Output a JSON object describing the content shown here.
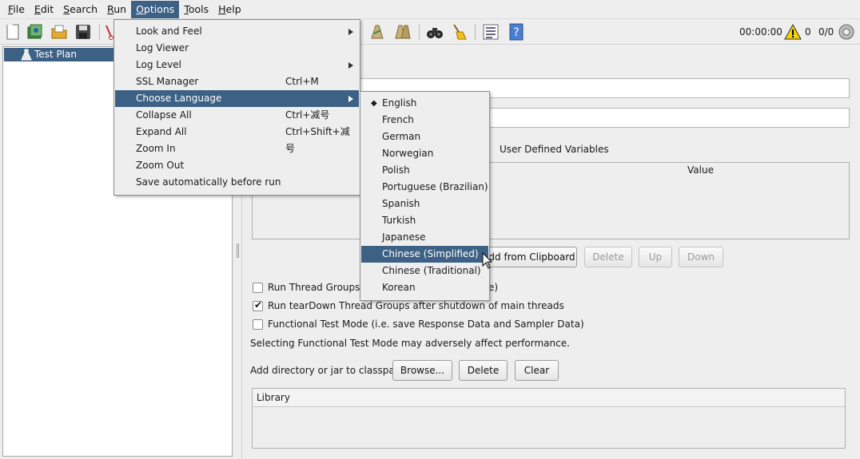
{
  "menubar": {
    "items": [
      "File",
      "Edit",
      "Search",
      "Run",
      "Options",
      "Tools",
      "Help"
    ],
    "active": "Options"
  },
  "toolbar": {
    "timer": "00:00:00",
    "warning_count": "0",
    "thread_ratio": "0/0"
  },
  "tree": {
    "root_label": "Test Plan"
  },
  "options_menu": {
    "items": [
      {
        "label": "Look and Feel",
        "accel": "",
        "submenu": true
      },
      {
        "label": "Log Viewer",
        "accel": "",
        "submenu": false
      },
      {
        "label": "Log Level",
        "accel": "",
        "submenu": true
      },
      {
        "label": "SSL Manager",
        "accel": "Ctrl+M",
        "submenu": false
      },
      {
        "label": "Choose Language",
        "accel": "",
        "submenu": true
      },
      {
        "label": "Collapse All",
        "accel": "Ctrl+减号",
        "submenu": false
      },
      {
        "label": "Expand All",
        "accel": "Ctrl+Shift+减号",
        "submenu": false
      },
      {
        "label": "Zoom In",
        "accel": "",
        "submenu": false
      },
      {
        "label": "Zoom Out",
        "accel": "",
        "submenu": false
      },
      {
        "label": "Save automatically before run",
        "accel": "",
        "submenu": false
      }
    ],
    "highlighted": "Choose Language"
  },
  "language_menu": {
    "items": [
      "English",
      "French",
      "German",
      "Norwegian",
      "Polish",
      "Portuguese (Brazilian)",
      "Spanish",
      "Turkish",
      "Japanese",
      "Chinese (Simplified)",
      "Chinese (Traditional)",
      "Korean"
    ],
    "selected": "English",
    "highlighted": "Chinese (Simplified)"
  },
  "panel": {
    "udv_title": "User Defined Variables",
    "value_header": "Value",
    "add_from_clipboard": "Add from Clipboard",
    "delete": "Delete",
    "up": "Up",
    "down": "Down",
    "run_thread_groups_visible_start": "Run Thread Groups c",
    "run_thread_groups_visible_end": "e)",
    "run_teardown": "Run tearDown Thread Groups after shutdown of main threads",
    "functional_mode": "Functional Test Mode (i.e. save Response Data and Sampler Data)",
    "functional_warning": "Selecting Functional Test Mode may adversely affect performance.",
    "classpath_label": "Add directory or jar to classpath",
    "browse": "Browse...",
    "delete2": "Delete",
    "clear": "Clear",
    "library_header": "Library"
  }
}
